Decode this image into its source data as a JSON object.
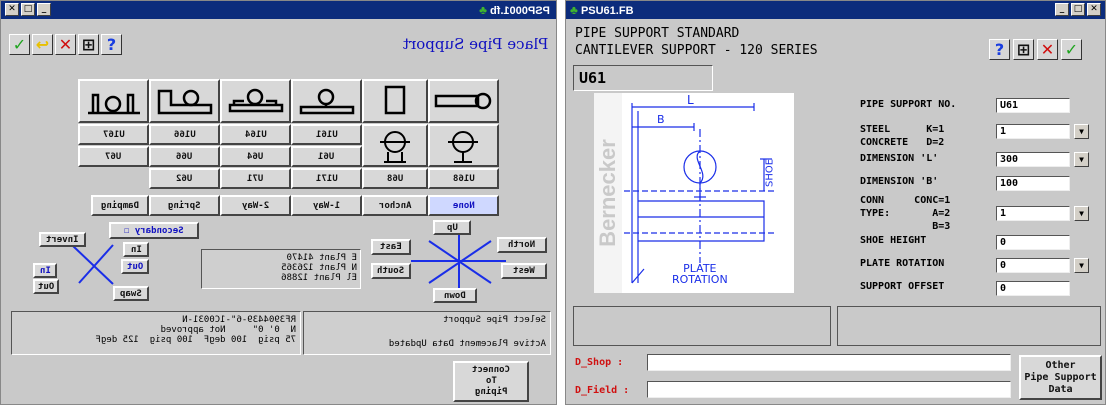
{
  "left": {
    "title": "PSP0001.fb",
    "heading": "Place Pipe Support",
    "toolbar": {
      "accept": "✓",
      "undo": "↩",
      "cancel": "✕",
      "grid": "⊞",
      "help": "?"
    },
    "support_rows": [
      [
        "U167",
        "U166",
        "U164",
        "U161"
      ],
      [
        "U67",
        "U66",
        "U64",
        "U61"
      ],
      [
        "U62",
        "U71",
        "U171",
        "U68",
        "U168"
      ]
    ],
    "type_buttons": [
      "None",
      "Anchor",
      "1-Way",
      "2-Way",
      "Spring",
      "Damping"
    ],
    "secondary": "Secondary",
    "invert": "Invert",
    "in_label": "In",
    "out_label": "Out",
    "swap": "Swap",
    "directions": {
      "up": "Up",
      "down": "Down",
      "north": "North",
      "south": "South",
      "east": "East",
      "west": "West"
    },
    "coords": [
      "E Plant 41470",
      "N Plant 126365",
      "El Plant 12886"
    ],
    "line_info": [
      "RF3904439-6\"-1C0031-N",
      "N  0' 0\"     Not approved",
      "75 psig  100 degF  100 psig  125 degF"
    ],
    "status_info": [
      "Select Pipe Support",
      "Active Placement Data Updated"
    ],
    "connect": [
      "Connect",
      "To",
      "Piping"
    ]
  },
  "right": {
    "title": "PSU61.FB",
    "heading_line1": "PIPE SUPPORT STANDARD",
    "heading_line2": "CANTILEVER SUPPORT - 120 SERIES",
    "code": "U61",
    "toolbar": {
      "help": "?",
      "grid": "⊞",
      "cancel": "✕",
      "accept": "✓"
    },
    "diagram": {
      "dim_l": "L",
      "dim_b": "B",
      "shoe": "SHOE",
      "plate_rotation_1": "PLATE",
      "plate_rotation_2": "ROTATION",
      "watermark": "Bernecker"
    },
    "fields": [
      {
        "label": "PIPE SUPPORT NO.",
        "value": "U61"
      },
      {
        "label": "STEEL      K=1\nCONCRETE   D=2",
        "value": "1"
      },
      {
        "label": "DIMENSION 'L'",
        "value": "300"
      },
      {
        "label": "DIMENSION 'B'",
        "value": "100"
      },
      {
        "label": "CONN     CONC=1\nTYPE:       A=2\n            B=3",
        "value": "1"
      },
      {
        "label": "SHOE HEIGHT",
        "value": "0"
      },
      {
        "label": "PLATE ROTATION",
        "value": "0"
      },
      {
        "label": "SUPPORT OFFSET",
        "value": "0"
      }
    ],
    "d_shop": "D_Shop :",
    "d_field": "D_Field :",
    "other_button": [
      "Other",
      "Pipe Support",
      "Data"
    ]
  },
  "colors": {
    "titlebar": "#0c2c7c",
    "diagram_blue": "#1a2ee8",
    "accent_red": "#d01010",
    "accent_green": "#1fa51f"
  }
}
